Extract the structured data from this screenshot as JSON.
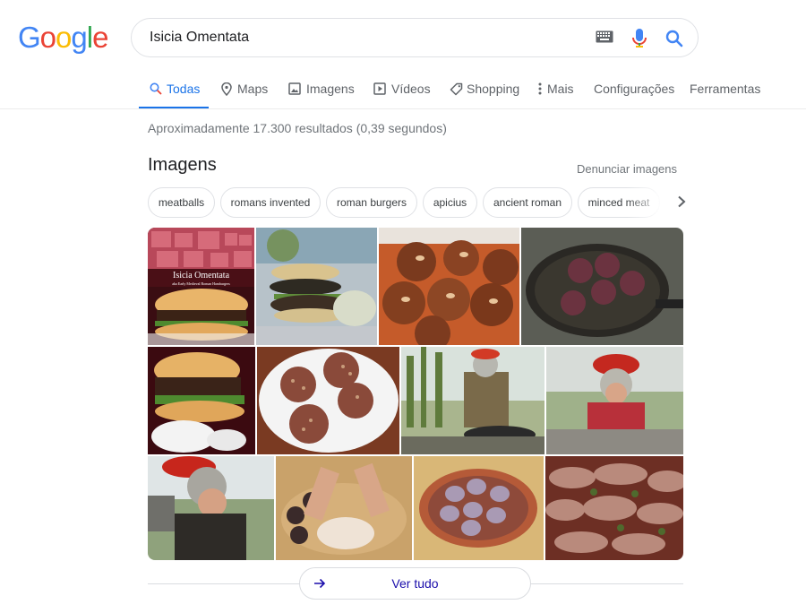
{
  "logo": {
    "letters": [
      "G",
      "o",
      "o",
      "g",
      "l",
      "e"
    ]
  },
  "search": {
    "query": "Isicia Omentata"
  },
  "tabs": [
    {
      "label": "Todas",
      "icon": "search-icon",
      "active": true
    },
    {
      "label": "Maps",
      "icon": "map-pin-icon"
    },
    {
      "label": "Imagens",
      "icon": "image-icon"
    },
    {
      "label": "Vídeos",
      "icon": "play-icon"
    },
    {
      "label": "Shopping",
      "icon": "tag-icon"
    },
    {
      "label": "Mais",
      "icon": "more-vert-icon"
    },
    {
      "label": "Configurações"
    },
    {
      "label": "Ferramentas"
    }
  ],
  "stats": "Aproximadamente 17.300 resultados (0,39 segundos)",
  "images": {
    "title": "Imagens",
    "report": "Denunciar imagens",
    "chips": [
      "meatballs",
      "romans invented",
      "roman burgers",
      "apicius",
      "ancient roman",
      "minced meat"
    ],
    "book_cover_title": "Isicia Omentata",
    "book_cover_subtitle": "aka Early Medieval Roman Hamburgers",
    "see_all": "Ver tudo"
  },
  "colors": {
    "accent": "#1a73e8",
    "link": "#1a0dab",
    "blue": "#4285f4",
    "red": "#ea4335",
    "yellow": "#fbbc05",
    "green": "#34a853"
  }
}
